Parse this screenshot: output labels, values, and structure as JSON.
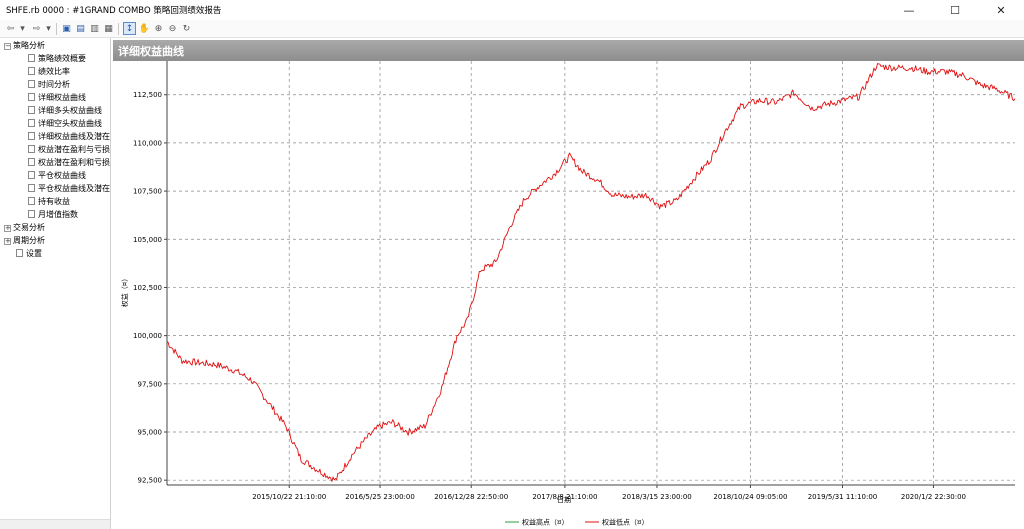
{
  "window": {
    "title": "SHFE.rb 0000 : #1GRAND COMBO 策略回测绩效报告",
    "min_glyph": "—",
    "max_glyph": "☐",
    "close_glyph": "✕"
  },
  "toolbar": {
    "icons": [
      "back-arrow-icon",
      "dropdown-icon",
      "forward-arrow-icon",
      "dropdown-icon",
      "save-icon",
      "export-icon",
      "print-icon",
      "preview-icon",
      "pointer-icon",
      "hand-icon",
      "zoom-in-icon",
      "zoom-out-icon",
      "refresh-icon"
    ],
    "glyphs": [
      "⇦",
      "▾",
      "⇨",
      "▾",
      "▣",
      "▤",
      "▥",
      "▦",
      "↕",
      "✋",
      "⊕",
      "⊖",
      "↻"
    ]
  },
  "tree": {
    "expand_glyph": "⊟",
    "collapse_glyph": "⊞",
    "items": [
      {
        "label": "策略分析",
        "level": 0,
        "expanded": true
      },
      {
        "label": "策略绩效概要",
        "level": 1
      },
      {
        "label": "绩效比率",
        "level": 1
      },
      {
        "label": "时间分析",
        "level": 1
      },
      {
        "label": "详细权益曲线",
        "level": 1
      },
      {
        "label": "详细多头权益曲线",
        "level": 1
      },
      {
        "label": "详细空头权益曲线",
        "level": 1
      },
      {
        "label": "详细权益曲线及潜在",
        "level": 1
      },
      {
        "label": "权益潜在盈利与亏损",
        "level": 1
      },
      {
        "label": "权益潜在盈利和亏损",
        "level": 1
      },
      {
        "label": "平仓权益曲线",
        "level": 1
      },
      {
        "label": "平仓权益曲线及潜在",
        "level": 1
      },
      {
        "label": "持有收益",
        "level": 1
      },
      {
        "label": "月增值指数",
        "level": 1
      },
      {
        "label": "交易分析",
        "level": 0,
        "expanded": false
      },
      {
        "label": "周期分析",
        "level": 0,
        "expanded": false
      },
      {
        "label": "设置",
        "level": 0,
        "leaf": true
      }
    ]
  },
  "panel": {
    "title": "详细权益曲线"
  },
  "colors": {
    "series_high": "#2e9d3a",
    "series_low": "#e01010",
    "grid": "#888888",
    "panel_header": "#9a9a9a"
  },
  "chart_data": {
    "type": "line",
    "title": "",
    "xlabel": "日期",
    "ylabel": "权益（¤）",
    "ylim": [
      92250,
      114250
    ],
    "yticks": [
      92500,
      95000,
      97500,
      100000,
      102500,
      105000,
      107500,
      110000,
      112500
    ],
    "ytick_labels": [
      "92,500",
      "95,000",
      "97,500",
      "100,000",
      "102,500",
      "105,000",
      "107,500",
      "110,000",
      "112,500"
    ],
    "x_range": [
      "2015-01-05",
      "2020-07-15"
    ],
    "xticks": [
      "2015-10-22 21:10",
      "2016-05-25 23:00",
      "2016-12-28 22:50",
      "2017-08-08 21:10",
      "2018-03-15 23:00",
      "2018-10-24 09:05",
      "2019-05-31 11:10",
      "2020-01-02 22:30"
    ],
    "xtick_labels": [
      "2015/10/22 21:10:00",
      "2016/5/25 23:00:00",
      "2016/12/28 22:50:00",
      "2017/8/8 21:10:00",
      "2018/3/15 23:00:00",
      "2018/10/24 09:05:00",
      "2019/5/31 11:10:00",
      "2020/1/2 22:30:00"
    ],
    "grid": true,
    "legend_position": "bottom",
    "series": [
      {
        "name": "权益高点（¤）",
        "color": "#2e9d3a",
        "values": []
      },
      {
        "name": "权益低点（¤）",
        "color": "#e01010",
        "x": [
          "2015-01-05",
          "2015-02-10",
          "2015-03-20",
          "2015-05-01",
          "2015-06-15",
          "2015-07-25",
          "2015-09-01",
          "2015-10-15",
          "2015-11-20",
          "2016-01-01",
          "2016-02-10",
          "2016-03-20",
          "2016-04-25",
          "2016-05-25",
          "2016-06-25",
          "2016-08-01",
          "2016-09-10",
          "2016-10-20",
          "2016-11-25",
          "2016-12-20",
          "2017-01-20",
          "2017-02-25",
          "2017-04-01",
          "2017-05-05",
          "2017-06-10",
          "2017-07-15",
          "2017-08-20",
          "2017-09-20",
          "2017-10-25",
          "2017-12-01",
          "2018-01-10",
          "2018-02-20",
          "2018-03-25",
          "2018-05-01",
          "2018-06-10",
          "2018-07-20",
          "2018-08-25",
          "2018-10-01",
          "2018-11-15",
          "2018-12-25",
          "2019-02-05",
          "2019-03-20",
          "2019-04-25",
          "2019-06-01",
          "2019-07-10",
          "2019-08-20",
          "2019-10-01",
          "2019-11-10",
          "2019-12-20",
          "2020-02-01",
          "2020-03-15",
          "2020-04-25",
          "2020-06-01",
          "2020-07-15"
        ],
        "values": [
          99700,
          98700,
          98600,
          98500,
          98200,
          97700,
          96600,
          95300,
          93600,
          93000,
          92500,
          93800,
          94700,
          95300,
          95500,
          95000,
          95300,
          97300,
          100000,
          100800,
          103400,
          103800,
          105700,
          107100,
          107800,
          108400,
          109300,
          108500,
          108100,
          107300,
          107200,
          107300,
          106700,
          107000,
          108100,
          109100,
          110600,
          111900,
          112200,
          112100,
          112600,
          111800,
          112000,
          112200,
          112400,
          114000,
          113900,
          113900,
          113700,
          113700,
          113500,
          113000,
          112800,
          112300
        ]
      }
    ]
  }
}
